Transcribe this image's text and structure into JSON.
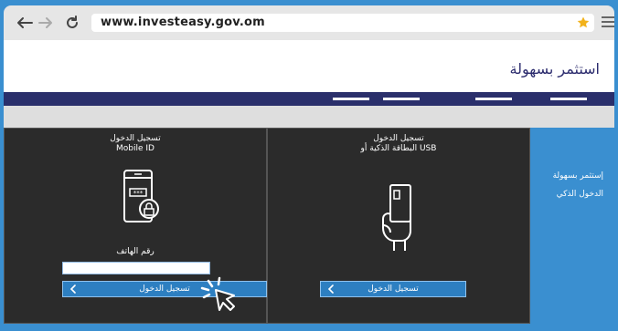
{
  "browser": {
    "url": "www.investeasy.gov.om"
  },
  "site": {
    "title": "استثمر بسهولة"
  },
  "sidebar": {
    "items": [
      {
        "label": "إستثمر بسهولة"
      },
      {
        "label": "الدخول الذكي"
      }
    ]
  },
  "mobile_panel": {
    "title_line1": "تسجيل الدخول",
    "title_line2": "Mobile ID",
    "phone_label": "رقم الهاتف",
    "phone_value": "",
    "button_label": "تسجيل الدخول"
  },
  "card_panel": {
    "title_line1": "تسجيل الدخول",
    "title_line2": "البطاقة الذكية أو USB",
    "button_label": "تسجيل الدخول"
  },
  "colors": {
    "background": "#3a8fd0",
    "navbar": "#2a2f6b",
    "panel": "#2b2b2b",
    "button": "#2d7fc1",
    "star": "#f2b21b"
  },
  "icons": [
    "back-arrow-icon",
    "forward-arrow-icon",
    "reload-icon",
    "star-icon",
    "menu-icon",
    "mobile-lock-icon",
    "card-hand-icon",
    "chevron-left-icon",
    "cursor-icon"
  ]
}
